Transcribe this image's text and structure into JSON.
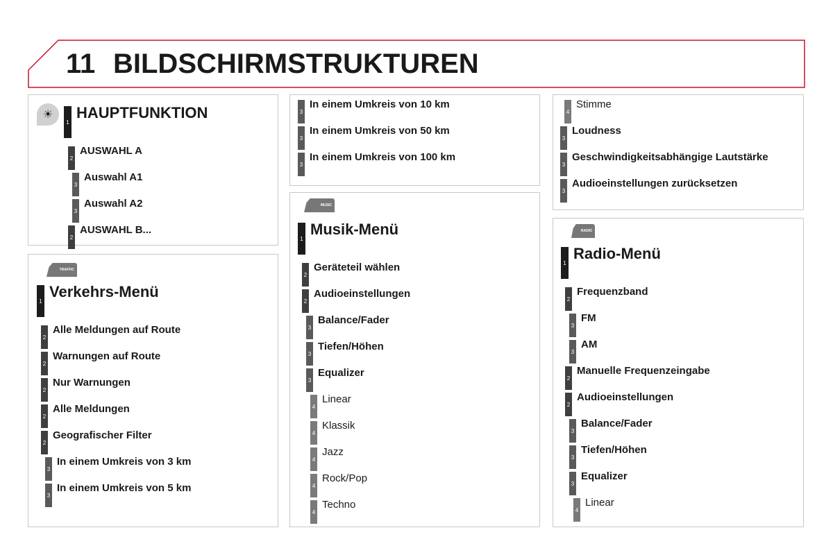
{
  "header": {
    "number": "11",
    "title": "BILDSCHIRMSTRUKTUREN",
    "accent": "#c8102e"
  },
  "panels": [
    {
      "id": "haupt",
      "icon": "lightbulb-icon",
      "items": [
        {
          "level": 1,
          "text": "HAUPTFUNKTION"
        },
        {
          "level": 2,
          "text": "AUSWAHL A"
        },
        {
          "level": 3,
          "text": "Auswahl A1"
        },
        {
          "level": 3,
          "text": "Auswahl A2"
        },
        {
          "level": 2,
          "text": "AUSWAHL B..."
        }
      ]
    },
    {
      "id": "verkehr",
      "icon": "traffic-tab-icon",
      "tab_label": "TRAFFIC",
      "items": [
        {
          "level": 1,
          "text": "Verkehrs-Menü"
        },
        {
          "level": 2,
          "text": "Alle Meldungen auf Route"
        },
        {
          "level": 2,
          "text": "Warnungen auf Route"
        },
        {
          "level": 2,
          "text": "Nur Warnungen"
        },
        {
          "level": 2,
          "text": "Alle Meldungen"
        },
        {
          "level": 2,
          "text": "Geografischer Filter"
        },
        {
          "level": 3,
          "text": "In einem Umkreis von 3 km"
        },
        {
          "level": 3,
          "text": "In einem Umkreis von 5 km"
        }
      ]
    },
    {
      "id": "verkehr-cont",
      "items": [
        {
          "level": 3,
          "text": "In einem Umkreis von 10 km"
        },
        {
          "level": 3,
          "text": "In einem Umkreis von 50 km"
        },
        {
          "level": 3,
          "text": "In einem Umkreis von 100 km"
        }
      ]
    },
    {
      "id": "musik",
      "icon": "music-tab-icon",
      "tab_label": "MUSIC",
      "items": [
        {
          "level": 1,
          "text": "Musik-Menü"
        },
        {
          "level": 2,
          "text": "Geräteteil wählen"
        },
        {
          "level": 2,
          "text": "Audioeinstellungen"
        },
        {
          "level": 3,
          "text": "Balance/Fader"
        },
        {
          "level": 3,
          "text": "Tiefen/Höhen"
        },
        {
          "level": 3,
          "text": "Equalizer"
        },
        {
          "level": 4,
          "text": "Linear"
        },
        {
          "level": 4,
          "text": "Klassik"
        },
        {
          "level": 4,
          "text": "Jazz"
        },
        {
          "level": 4,
          "text": "Rock/Pop"
        },
        {
          "level": 4,
          "text": "Techno"
        }
      ]
    },
    {
      "id": "musik-cont",
      "items": [
        {
          "level": 4,
          "text": "Stimme"
        },
        {
          "level": 3,
          "text": "Loudness"
        },
        {
          "level": 3,
          "text": "Geschwindigkeitsabhängige Lautstärke"
        },
        {
          "level": 3,
          "text": "Audioeinstellungen zurücksetzen"
        }
      ]
    },
    {
      "id": "radio",
      "icon": "radio-tab-icon",
      "tab_label": "RADIO",
      "items": [
        {
          "level": 1,
          "text": "Radio-Menü"
        },
        {
          "level": 2,
          "text": "Frequenzband"
        },
        {
          "level": 3,
          "text": "FM"
        },
        {
          "level": 3,
          "text": "AM"
        },
        {
          "level": 2,
          "text": "Manuelle Frequenzeingabe"
        },
        {
          "level": 2,
          "text": "Audioeinstellungen"
        },
        {
          "level": 3,
          "text": "Balance/Fader"
        },
        {
          "level": 3,
          "text": "Tiefen/Höhen"
        },
        {
          "level": 3,
          "text": "Equalizer"
        },
        {
          "level": 4,
          "text": "Linear"
        }
      ]
    }
  ]
}
